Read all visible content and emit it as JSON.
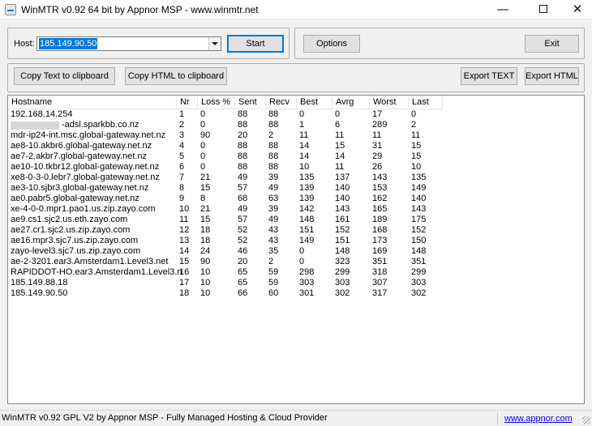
{
  "window": {
    "title": "WinMTR v0.92 64 bit by Appnor MSP - www.winmtr.net",
    "minimize_glyph": "—",
    "close_glyph": "✕"
  },
  "controls": {
    "host_label": "Host:",
    "host_value": "185.149.90.50",
    "start_label": "Start",
    "options_label": "Options",
    "exit_label": "Exit",
    "copy_text_label": "Copy Text to clipboard",
    "copy_html_label": "Copy HTML to clipboard",
    "export_text_label": "Export TEXT",
    "export_html_label": "Export HTML"
  },
  "table": {
    "columns": [
      "Hostname",
      "Nr",
      "Loss %",
      "Sent",
      "Recv",
      "Best",
      "Avrg",
      "Worst",
      "Last"
    ],
    "rows": [
      [
        "192.168.14.254",
        "1",
        "0",
        "88",
        "88",
        "0",
        "0",
        "17",
        "0"
      ],
      [
        "-adsl.sparkbb.co.nz",
        "2",
        "0",
        "88",
        "88",
        "1",
        "6",
        "289",
        "2"
      ],
      [
        "mdr-ip24-int.msc.global-gateway.net.nz",
        "3",
        "90",
        "20",
        "2",
        "11",
        "11",
        "11",
        "11"
      ],
      [
        "ae8-10.akbr6.global-gateway.net.nz",
        "4",
        "0",
        "88",
        "88",
        "14",
        "15",
        "31",
        "15"
      ],
      [
        "ae7-2.akbr7.global-gateway.net.nz",
        "5",
        "0",
        "88",
        "88",
        "14",
        "14",
        "29",
        "15"
      ],
      [
        "ae10-10.tkbr12.global-gateway.net.nz",
        "6",
        "0",
        "88",
        "88",
        "10",
        "11",
        "26",
        "10"
      ],
      [
        "xe8-0-3-0.lebr7.global-gateway.net.nz",
        "7",
        "21",
        "49",
        "39",
        "135",
        "137",
        "143",
        "135"
      ],
      [
        "ae3-10.sjbr3.global-gateway.net.nz",
        "8",
        "15",
        "57",
        "49",
        "139",
        "140",
        "153",
        "149"
      ],
      [
        "ae0.pabr5.global-gateway.net.nz",
        "9",
        "8",
        "68",
        "63",
        "139",
        "140",
        "162",
        "140"
      ],
      [
        "xe-4-0-0.mpr1.pao1.us.zip.zayo.com",
        "10",
        "21",
        "49",
        "39",
        "142",
        "143",
        "165",
        "143"
      ],
      [
        "ae9.cs1.sjc2.us.eth.zayo.com",
        "11",
        "15",
        "57",
        "49",
        "148",
        "161",
        "189",
        "175"
      ],
      [
        "ae27.cr1.sjc2.us.zip.zayo.com",
        "12",
        "18",
        "52",
        "43",
        "151",
        "152",
        "168",
        "152"
      ],
      [
        "ae16.mpr3.sjc7.us.zip.zayo.com",
        "13",
        "18",
        "52",
        "43",
        "149",
        "151",
        "173",
        "150"
      ],
      [
        "zayo-level3.sjc7.us.zip.zayo.com",
        "14",
        "24",
        "46",
        "35",
        "0",
        "148",
        "169",
        "148"
      ],
      [
        "ae-2-3201.ear3.Amsterdam1.Level3.net",
        "15",
        "90",
        "20",
        "2",
        "0",
        "323",
        "351",
        "351"
      ],
      [
        "RAPIDDOT-HO.ear3.Amsterdam1.Level3.net",
        "16",
        "10",
        "65",
        "59",
        "298",
        "299",
        "318",
        "299"
      ],
      [
        "185.149.88.18",
        "17",
        "10",
        "65",
        "59",
        "303",
        "303",
        "307",
        "303"
      ],
      [
        "185.149.90.50",
        "18",
        "10",
        "66",
        "60",
        "301",
        "302",
        "317",
        "302"
      ]
    ]
  },
  "status": {
    "text": "WinMTR v0.92 GPL V2 by Appnor MSP - Fully Managed Hosting & Cloud Provider",
    "link": "www.appnor.com"
  },
  "colors": {
    "selection": "#0078d7",
    "link": "#0000ff"
  }
}
